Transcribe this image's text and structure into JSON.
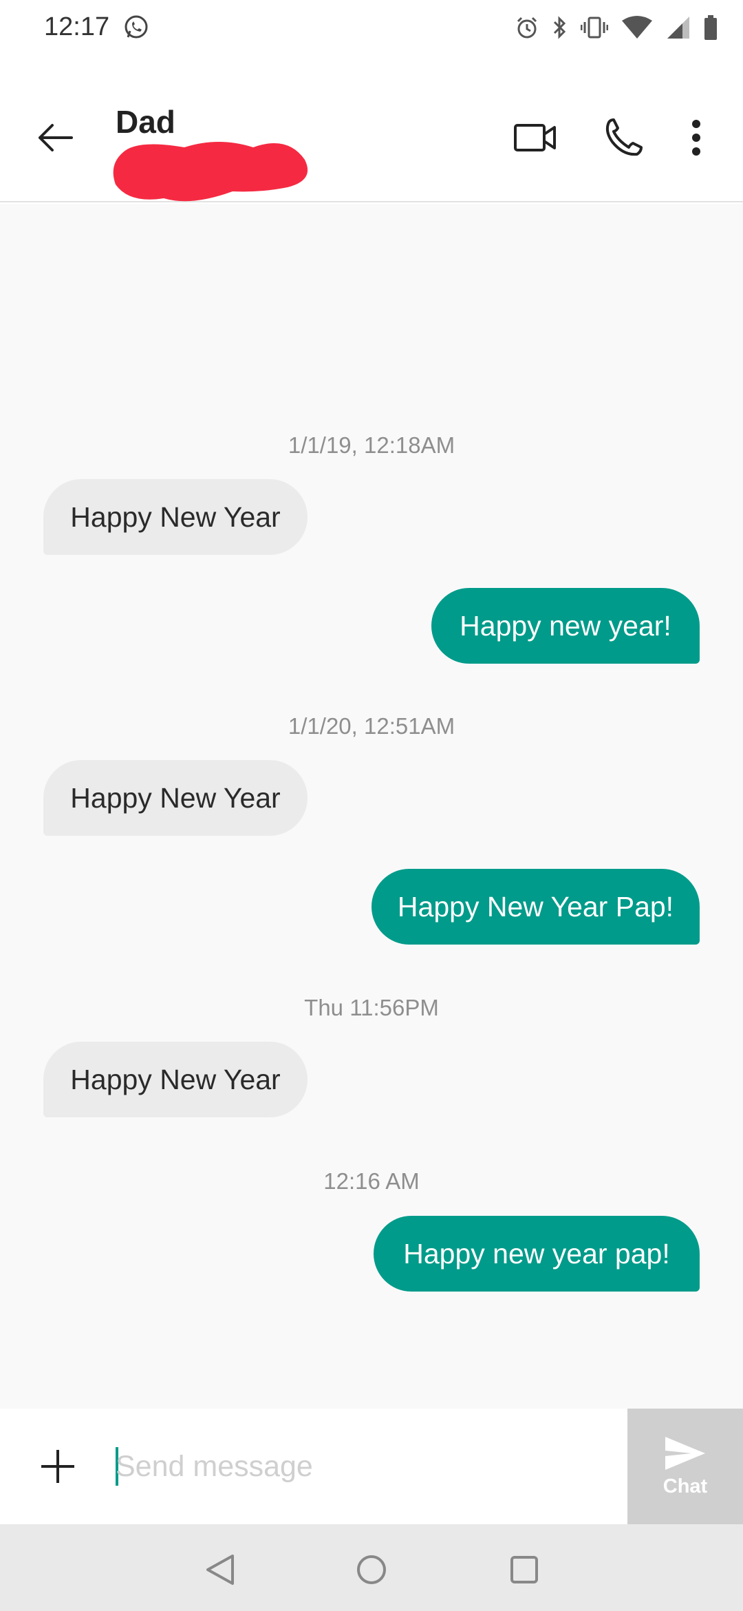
{
  "status_bar": {
    "time": "12:17",
    "icons": [
      "whatsapp-icon",
      "alarm-icon",
      "bluetooth-icon",
      "vibrate-icon",
      "wifi-icon",
      "signal-icon",
      "battery-icon"
    ]
  },
  "header": {
    "contact_name": "Dad",
    "actions": [
      "video-call-icon",
      "phone-icon",
      "more-vert-icon"
    ]
  },
  "conversation": {
    "timestamps": [
      "1/1/19, 12:18AM",
      "1/1/20, 12:51AM",
      "Thu 11:56PM",
      "12:16 AM"
    ],
    "messages": [
      {
        "direction": "incoming",
        "text": "Happy New Year"
      },
      {
        "direction": "outgoing",
        "text": "Happy new year!"
      },
      {
        "direction": "incoming",
        "text": "Happy New Year"
      },
      {
        "direction": "outgoing",
        "text": "Happy New Year Pap!"
      },
      {
        "direction": "incoming",
        "text": "Happy New Year"
      },
      {
        "direction": "outgoing",
        "text": "Happy new year pap!"
      }
    ]
  },
  "composer": {
    "placeholder": "Send message",
    "value": "",
    "send_label": "Chat"
  },
  "colors": {
    "accent": "#009b8a",
    "incoming_bubble": "#ebebeb",
    "redaction": "#f52a42"
  }
}
